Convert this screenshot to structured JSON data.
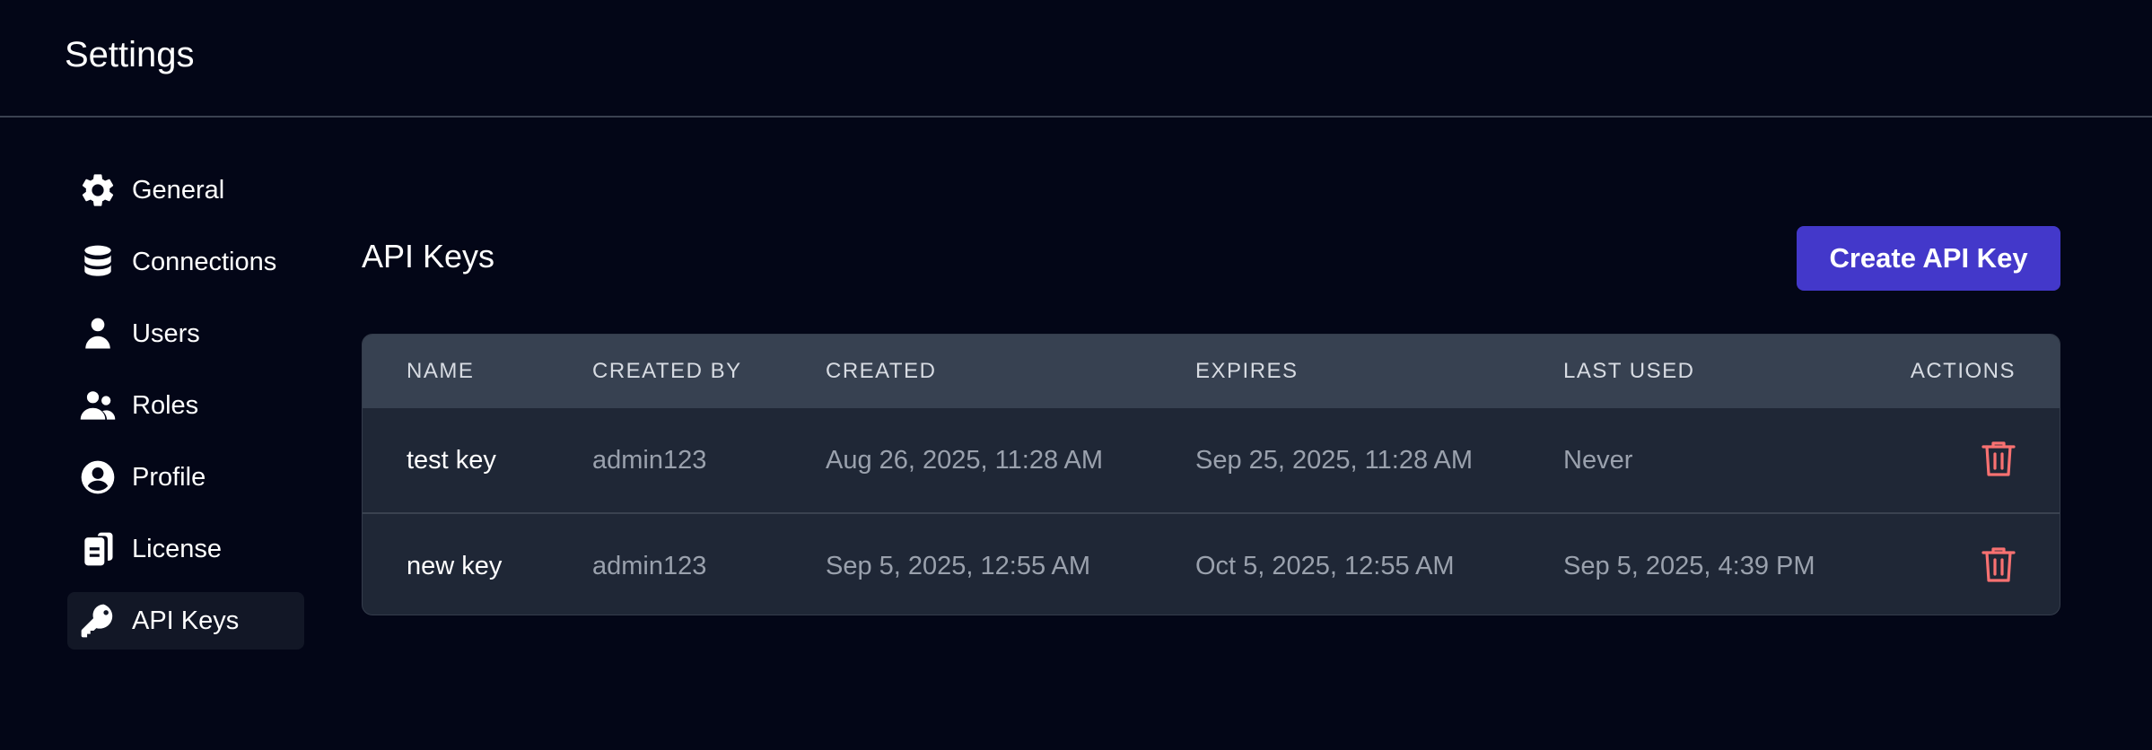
{
  "header": {
    "title": "Settings"
  },
  "sidebar": {
    "items": [
      {
        "label": "General",
        "icon": "gear-icon"
      },
      {
        "label": "Connections",
        "icon": "database-icon"
      },
      {
        "label": "Users",
        "icon": "user-icon"
      },
      {
        "label": "Roles",
        "icon": "users-group-icon"
      },
      {
        "label": "Profile",
        "icon": "user-circle-icon"
      },
      {
        "label": "License",
        "icon": "license-icon"
      },
      {
        "label": "API Keys",
        "icon": "key-icon",
        "active": true
      }
    ]
  },
  "main": {
    "title": "API Keys",
    "create_button": "Create API Key",
    "accent_color": "#4338ca",
    "delete_icon_color": "#f87171"
  },
  "table": {
    "columns": [
      "NAME",
      "CREATED BY",
      "CREATED",
      "EXPIRES",
      "LAST USED",
      "ACTIONS"
    ],
    "rows": [
      {
        "name": "test key",
        "created_by": "admin123",
        "created": "Aug 26, 2025, 11:28 AM",
        "expires": "Sep 25, 2025, 11:28 AM",
        "last_used": "Never"
      },
      {
        "name": "new key",
        "created_by": "admin123",
        "created": "Sep 5, 2025, 12:55 AM",
        "expires": "Oct 5, 2025, 12:55 AM",
        "last_used": "Sep 5, 2025, 4:39 PM"
      }
    ]
  }
}
